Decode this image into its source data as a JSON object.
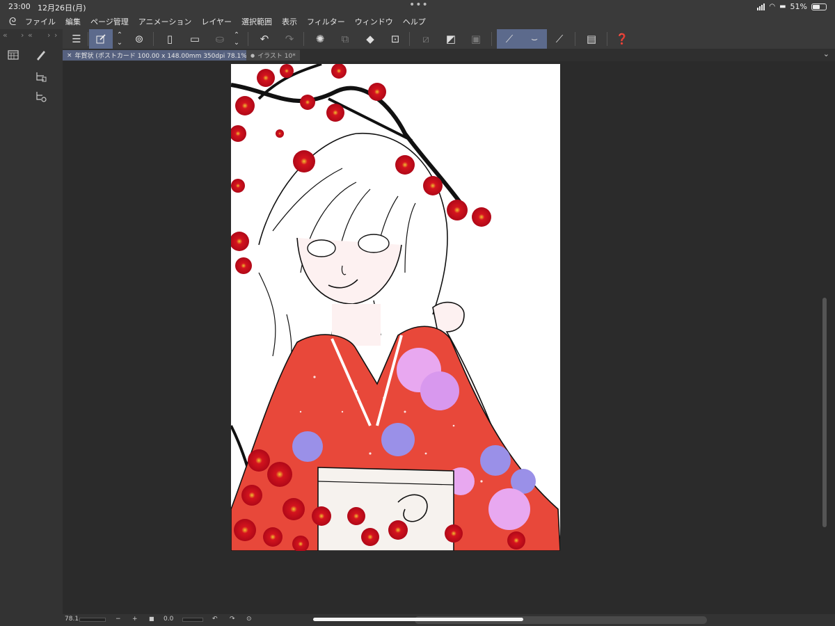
{
  "status_bar": {
    "time": "23:00",
    "date": "12月26日(月)",
    "battery": "51%"
  },
  "menu": {
    "items": [
      "ファイル",
      "編集",
      "ページ管理",
      "アニメーション",
      "レイヤー",
      "選択範囲",
      "表示",
      "フィルター",
      "ウィンドウ",
      "ヘルプ"
    ]
  },
  "tabs": [
    {
      "label": "年賀状 (ポストカード 100.00 x 148.00mm 350dpi 78.1%)",
      "close": "×"
    },
    {
      "label": "イラスト 10*",
      "dot": "●"
    }
  ],
  "bottom_bar": {
    "zoom": "78.1",
    "rotation": "0.0",
    "minus": "−",
    "plus": "+"
  },
  "colors": {
    "active_tool": "#5c6a8c",
    "active_tab": "#56617f",
    "kimono": "#e8483a",
    "blossom": "#c8101c"
  }
}
